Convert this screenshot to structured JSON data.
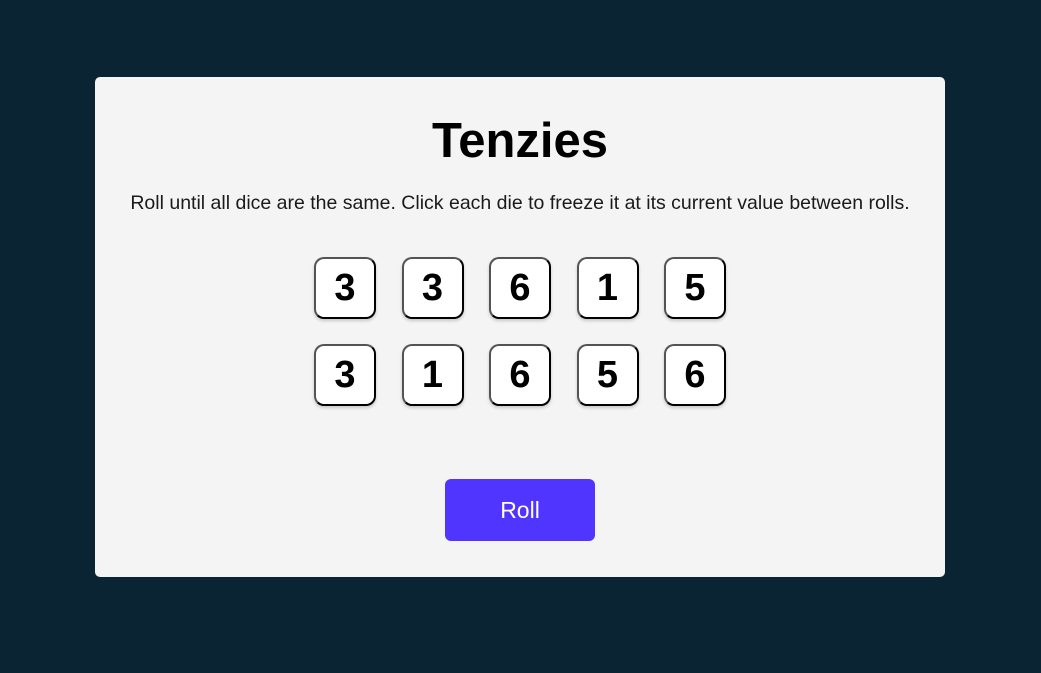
{
  "game": {
    "title": "Tenzies",
    "instructions": "Roll until all dice are the same. Click each die to freeze it at its current value between rolls.",
    "roll_label": "Roll"
  },
  "dice": [
    {
      "value": "3",
      "held": false
    },
    {
      "value": "3",
      "held": false
    },
    {
      "value": "6",
      "held": false
    },
    {
      "value": "1",
      "held": false
    },
    {
      "value": "5",
      "held": false
    },
    {
      "value": "3",
      "held": false
    },
    {
      "value": "1",
      "held": false
    },
    {
      "value": "6",
      "held": false
    },
    {
      "value": "5",
      "held": false
    },
    {
      "value": "6",
      "held": false
    }
  ],
  "colors": {
    "page_background": "#0b2434",
    "card_background": "#f4f4f4",
    "die_background": "#ffffff",
    "held_die_background": "#59e391",
    "roll_button": "#5035ff"
  }
}
